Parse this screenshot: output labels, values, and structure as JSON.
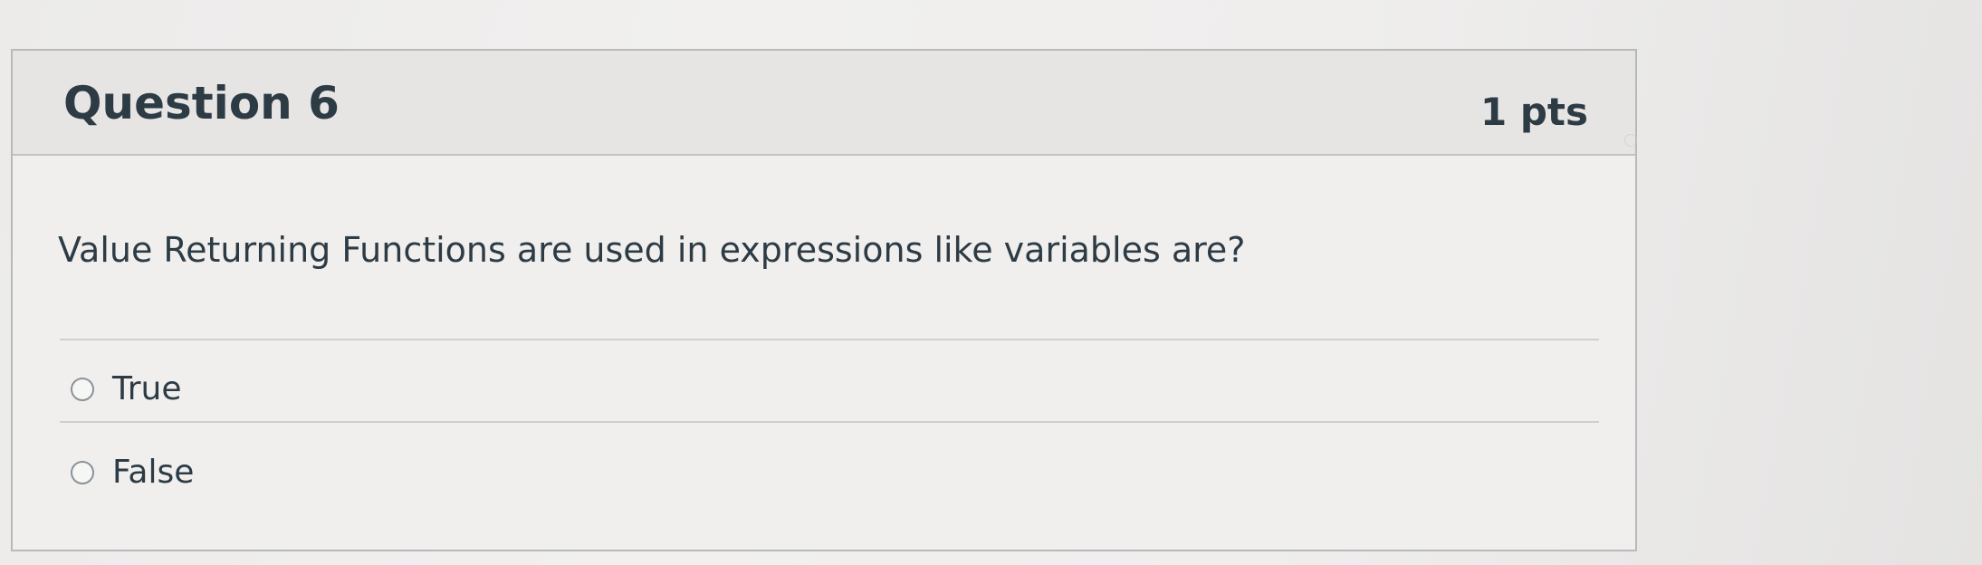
{
  "question": {
    "title": "Question 6",
    "points": "1 pts",
    "text": "Value Returning Functions are used in expressions like variables are?",
    "answers": [
      {
        "label": "True",
        "selected": false
      },
      {
        "label": "False",
        "selected": false
      }
    ]
  },
  "colors": {
    "text": "#2d3b45",
    "header_background": "#e6e5e4",
    "border": "#b9b9b9"
  },
  "icons": {
    "radio": "radio-empty-icon"
  }
}
